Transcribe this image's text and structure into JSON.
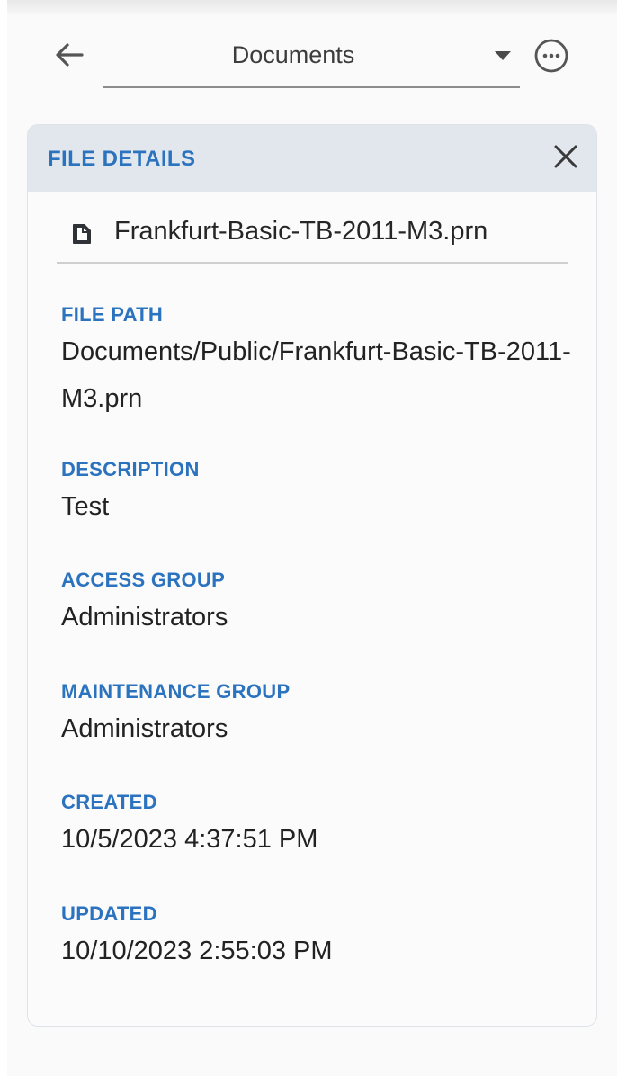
{
  "header": {
    "back_icon": "arrow-left-icon",
    "location_value": "Documents",
    "dropdown_icon": "caret-down-icon",
    "more_icon": "more-horizontal-circle-icon"
  },
  "panel": {
    "title": "FILE DETAILS",
    "close_icon": "close-icon",
    "file_icon": "document-icon",
    "file_name": "Frankfurt-Basic-TB-2011-M3.prn",
    "fields": {
      "file_path": {
        "label": "FILE PATH",
        "value": "Documents/Public/Frankfurt-Basic-TB-2011-M3.prn"
      },
      "description": {
        "label": "DESCRIPTION",
        "value": "Test"
      },
      "access_group": {
        "label": "ACCESS GROUP",
        "value": "Administrators"
      },
      "maintenance_group": {
        "label": "MAINTENANCE GROUP",
        "value": "Administrators"
      },
      "created": {
        "label": "CREATED",
        "value": "10/5/2023 4:37:51 PM"
      },
      "updated": {
        "label": "UPDATED",
        "value": "10/10/2023 2:55:03 PM"
      }
    }
  },
  "colors": {
    "accent": "#2b73be",
    "panel_header_bg": "#e1e7ec",
    "text_primary": "#222222"
  }
}
